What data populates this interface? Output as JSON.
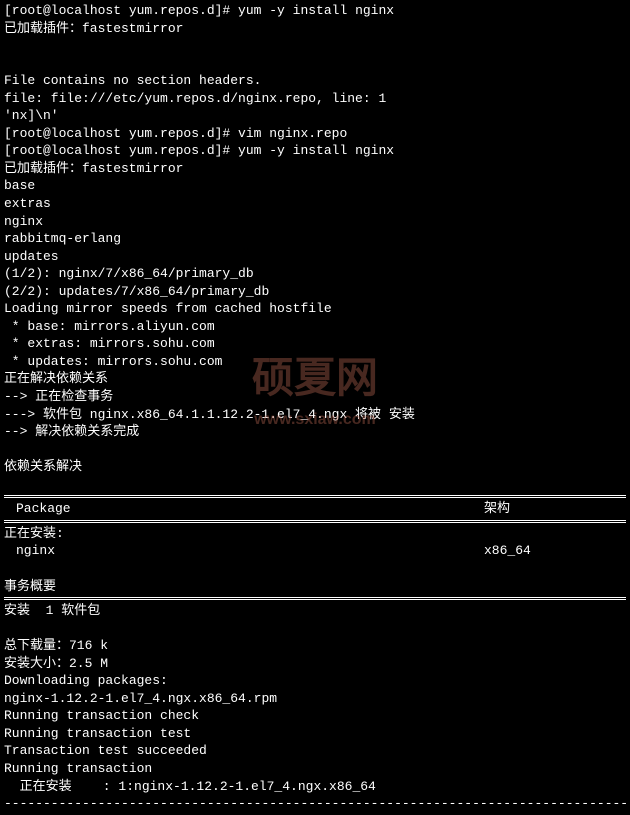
{
  "prompt": "[root@localhost yum.repos.d]# ",
  "cmd1": "yum -y install nginx",
  "plugin1": "已加载插件：fastestmirror",
  "blank": " ",
  "err1": "File contains no section headers.",
  "err2": "file: file:///etc/yum.repos.d/nginx.repo, line: 1",
  "err3": "'nx]\\n'",
  "cmd2": "vim nginx.repo",
  "cmd3": "yum -y install nginx",
  "plugin2": "已加载插件：fastestmirror",
  "repo1": "base",
  "repo2": "extras",
  "repo3": "nginx",
  "repo4": "rabbitmq-erlang",
  "repo5": "updates",
  "dl1": "(1/2): nginx/7/x86_64/primary_db",
  "dl2": "(2/2): updates/7/x86_64/primary_db",
  "loading": "Loading mirror speeds from cached hostfile",
  "mirror1": " * base: mirrors.aliyun.com",
  "mirror2": " * extras: mirrors.sohu.com",
  "mirror3": " * updates: mirrors.sohu.com",
  "dep1": "正在解决依赖关系",
  "dep2": "--> 正在检查事务",
  "dep3": "---> 软件包 nginx.x86_64.1.1.12.2-1.el7_4.ngx 将被 安装",
  "dep4": "--> 解决依赖关系完成",
  "depdone": "依赖关系解决",
  "hdr_package": "Package",
  "hdr_arch": "架构",
  "installing": "正在安装:",
  "pkg_name": " nginx",
  "pkg_arch": "x86_64",
  "summary": "事务概要",
  "install_count": "安装  1 软件包",
  "total_dl": "总下载量：716 k",
  "install_size": "安装大小：2.5 M",
  "dlpkg": "Downloading packages:",
  "rpm": "nginx-1.12.2-1.el7_4.ngx.x86_64.rpm",
  "rtc": "Running transaction check",
  "rtt": "Running transaction test",
  "tts": "Transaction test succeeded",
  "rt": "Running transaction",
  "installing_line": "  正在安装    : 1:nginx-1.12.2-1.el7_4.ngx.x86_64",
  "dashes": "---------------------------------------------------------------------------------------",
  "watermark_big": "硕夏网",
  "watermark_small": "www.sxiaw.com"
}
